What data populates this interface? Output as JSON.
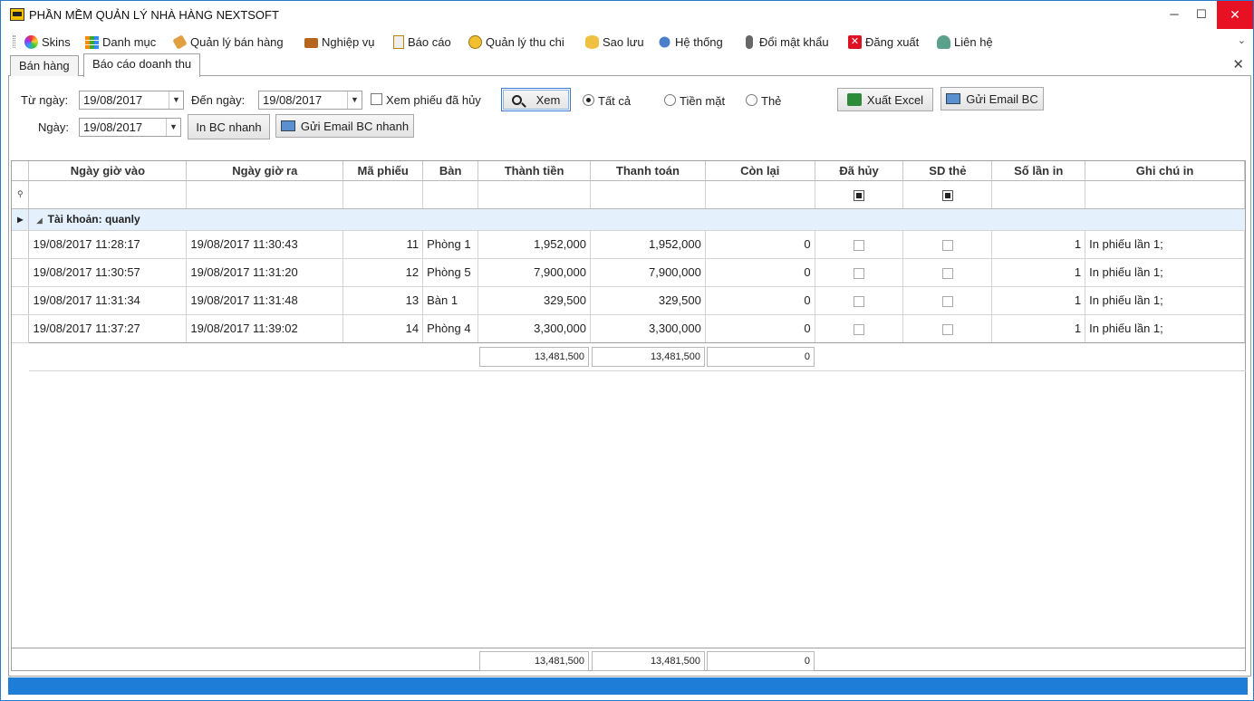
{
  "window": {
    "title": "PHẦN MỀM QUẢN LÝ NHÀ HÀNG NEXTSOFT",
    "minimize": "─",
    "maximize": "☐",
    "close": "✕"
  },
  "menu": [
    {
      "label": "Skins",
      "icon": "palette-icon"
    },
    {
      "label": "Danh mục",
      "icon": "grid-icon"
    },
    {
      "label": "Quản lý bán hàng",
      "icon": "tag-icon"
    },
    {
      "label": "Nghiệp vụ",
      "icon": "briefcase-icon"
    },
    {
      "label": "Báo cáo",
      "icon": "clipboard-icon"
    },
    {
      "label": "Quản lý thu chi",
      "icon": "coins-icon"
    },
    {
      "label": "Sao lưu",
      "icon": "database-icon"
    },
    {
      "label": "Hệ thống",
      "icon": "gear-icon"
    },
    {
      "label": "Đổi mật khẩu",
      "icon": "microphone-icon"
    },
    {
      "label": "Đăng xuất",
      "icon": "exit-icon"
    },
    {
      "label": "Liên hệ",
      "icon": "user-icon"
    }
  ],
  "tabs": [
    {
      "label": "Bán hàng"
    },
    {
      "label": "Báo cáo doanh thu"
    }
  ],
  "filters": {
    "from_label": "Từ ngày:",
    "from_value": "19/08/2017",
    "to_label": "Đến ngày:",
    "to_value": "19/08/2017",
    "show_cancelled_label": "Xem phiếu đã hủy",
    "view_button": "Xem",
    "radio_all": "Tất cả",
    "radio_cash": "Tiền mặt",
    "radio_card": "Thẻ",
    "export_excel": "Xuất Excel",
    "send_email": "Gửi Email BC",
    "day_label": "Ngày:",
    "day_value": "19/08/2017",
    "quick_print": "In BC nhanh",
    "quick_email": "Gửi Email BC nhanh"
  },
  "grid": {
    "columns": [
      "Ngày giờ vào",
      "Ngày giờ ra",
      "Mã phiếu",
      "Bàn",
      "Thành tiền",
      "Thanh toán",
      "Còn lại",
      "Đã hủy",
      "SD thẻ",
      "Số lần in",
      "Ghi chú in"
    ],
    "group_label": "Tài khoản: quanly",
    "rows": [
      {
        "in": "19/08/2017 11:28:17",
        "out": "19/08/2017 11:30:43",
        "id": "11",
        "table": "Phòng 1",
        "amount": "1,952,000",
        "paid": "1,952,000",
        "remain": "0",
        "prints": "1",
        "note": "In phiếu lần 1;"
      },
      {
        "in": "19/08/2017 11:30:57",
        "out": "19/08/2017 11:31:20",
        "id": "12",
        "table": "Phòng 5",
        "amount": "7,900,000",
        "paid": "7,900,000",
        "remain": "0",
        "prints": "1",
        "note": "In phiếu lần 1;"
      },
      {
        "in": "19/08/2017 11:31:34",
        "out": "19/08/2017 11:31:48",
        "id": "13",
        "table": "Bàn 1",
        "amount": "329,500",
        "paid": "329,500",
        "remain": "0",
        "prints": "1",
        "note": "In phiếu lần 1;"
      },
      {
        "in": "19/08/2017 11:37:27",
        "out": "19/08/2017 11:39:02",
        "id": "14",
        "table": "Phòng 4",
        "amount": "3,300,000",
        "paid": "3,300,000",
        "remain": "0",
        "prints": "1",
        "note": "In phiếu lần 1;"
      }
    ],
    "group_totals": {
      "amount": "13,481,500",
      "paid": "13,481,500",
      "remain": "0"
    },
    "totals": {
      "amount": "13,481,500",
      "paid": "13,481,500",
      "remain": "0"
    }
  },
  "colors": {
    "statusbar": "#1e7dd6",
    "close": "#e81123",
    "group_row": "#e4f0fb"
  }
}
